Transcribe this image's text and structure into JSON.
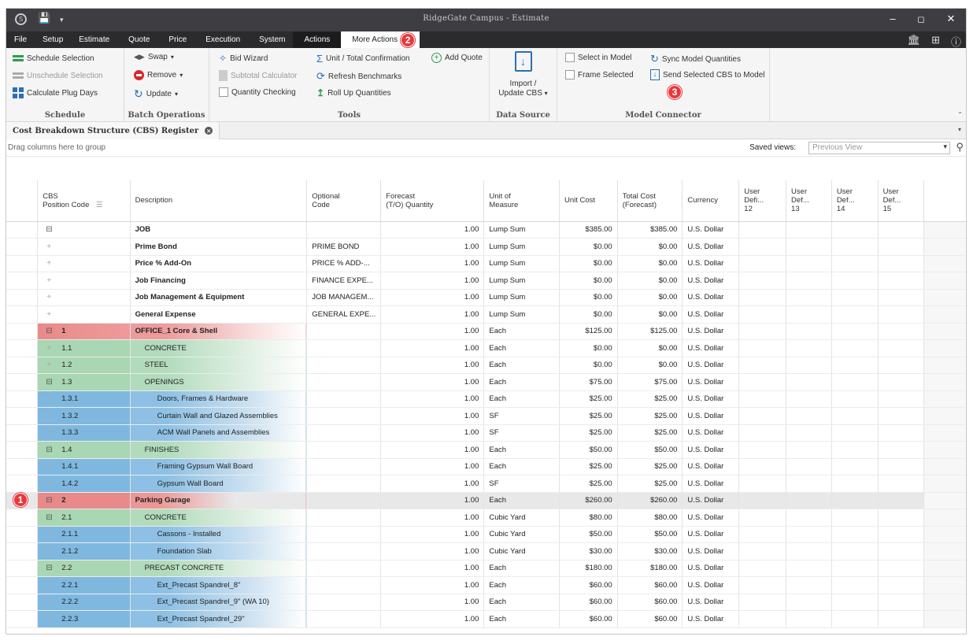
{
  "window": {
    "title": "RidgeGate Campus - Estimate"
  },
  "menu": {
    "items": [
      "File",
      "Setup",
      "Estimate",
      "Quote",
      "Price",
      "Execution",
      "System",
      "Actions",
      "More Actions"
    ],
    "badge": "2"
  },
  "ribbon": {
    "schedule": {
      "label": "Schedule",
      "items": [
        "Schedule Selection",
        "Unschedule Selection",
        "Calculate Plug Days"
      ]
    },
    "batch": {
      "label": "Batch Operations",
      "swap": "Swap",
      "remove": "Remove",
      "update": "Update"
    },
    "tools": {
      "label": "Tools",
      "bid_wizard": "Bid Wizard",
      "subtotal": "Subtotal Calculator",
      "qty_check": "Quantity Checking",
      "unit_total": "Unit / Total Confirmation",
      "refresh": "Refresh Benchmarks",
      "rollup": "Roll Up Quantities",
      "add_quote": "Add Quote"
    },
    "data_source": {
      "label": "Data Source",
      "import_line1": "Import /",
      "import_line2": "Update CBS"
    },
    "model": {
      "label": "Model Connector",
      "select": "Select in Model",
      "frame": "Frame Selected",
      "sync": "Sync Model Quantities",
      "send": "Send Selected CBS to Model",
      "badge": "3"
    }
  },
  "doc_tab": {
    "label": "Cost Breakdown Structure (CBS) Register"
  },
  "grid_bar": {
    "hint": "Drag columns here to group",
    "saved_views_label": "Saved views:",
    "saved_views_value": "Previous View"
  },
  "columns": {
    "cbs": "CBS",
    "cbs2": "Position Code",
    "desc": "Description",
    "opt1": "Optional",
    "opt2": "Code",
    "fq1": "Forecast",
    "fq2": "(T/O) Quantity",
    "uom1": "Unit of",
    "uom2": "Measure",
    "uc": "Unit Cost",
    "tc1": "Total Cost",
    "tc2": "(Forecast)",
    "cur": "Currency",
    "u12a": "User",
    "u12b": "Defi...",
    "u12c": "12",
    "u13a": "User",
    "u13b": "Def...",
    "u13c": "13",
    "u14a": "User",
    "u14b": "Def...",
    "u14c": "14",
    "u15a": "User",
    "u15b": "Def...",
    "u15c": "15"
  },
  "rows": [
    {
      "code": "",
      "desc": "JOB",
      "opt": "",
      "qty": "1.00",
      "uom": "Lump Sum",
      "uc": "$385.00",
      "tc": "$385.00",
      "cur": "U.S. Dollar"
    },
    {
      "code": "",
      "desc": "Prime Bond",
      "opt": "PRIME BOND",
      "qty": "1.00",
      "uom": "Lump Sum",
      "uc": "$0.00",
      "tc": "$0.00",
      "cur": "U.S. Dollar"
    },
    {
      "code": "",
      "desc": "Price % Add-On",
      "opt": "PRICE % ADD-...",
      "qty": "1.00",
      "uom": "Lump Sum",
      "uc": "$0.00",
      "tc": "$0.00",
      "cur": "U.S. Dollar"
    },
    {
      "code": "",
      "desc": "Job Financing",
      "opt": "FINANCE EXPE...",
      "qty": "1.00",
      "uom": "Lump Sum",
      "uc": "$0.00",
      "tc": "$0.00",
      "cur": "U.S. Dollar"
    },
    {
      "code": "",
      "desc": "Job Management & Equipment",
      "opt": "JOB MANAGEM...",
      "qty": "1.00",
      "uom": "Lump Sum",
      "uc": "$0.00",
      "tc": "$0.00",
      "cur": "U.S. Dollar"
    },
    {
      "code": "",
      "desc": "General Expense",
      "opt": "GENERAL EXPE...",
      "qty": "1.00",
      "uom": "Lump Sum",
      "uc": "$0.00",
      "tc": "$0.00",
      "cur": "U.S. Dollar"
    },
    {
      "code": "1",
      "desc": "OFFICE_1 Core & Shell",
      "opt": "",
      "qty": "1.00",
      "uom": "Each",
      "uc": "$125.00",
      "tc": "$125.00",
      "cur": "U.S. Dollar"
    },
    {
      "code": "1.1",
      "desc": "CONCRETE",
      "opt": "",
      "qty": "1.00",
      "uom": "Each",
      "uc": "$0.00",
      "tc": "$0.00",
      "cur": "U.S. Dollar"
    },
    {
      "code": "1.2",
      "desc": "STEEL",
      "opt": "",
      "qty": "1.00",
      "uom": "Each",
      "uc": "$0.00",
      "tc": "$0.00",
      "cur": "U.S. Dollar"
    },
    {
      "code": "1.3",
      "desc": "OPENINGS",
      "opt": "",
      "qty": "1.00",
      "uom": "Each",
      "uc": "$75.00",
      "tc": "$75.00",
      "cur": "U.S. Dollar"
    },
    {
      "code": "1.3.1",
      "desc": "Doors, Frames & Hardware",
      "opt": "",
      "qty": "1.00",
      "uom": "Each",
      "uc": "$25.00",
      "tc": "$25.00",
      "cur": "U.S. Dollar"
    },
    {
      "code": "1.3.2",
      "desc": "Curtain Wall and Glazed Assemblies",
      "opt": "",
      "qty": "1.00",
      "uom": "SF",
      "uc": "$25.00",
      "tc": "$25.00",
      "cur": "U.S. Dollar"
    },
    {
      "code": "1.3.3",
      "desc": "ACM Wall Panels and Assemblies",
      "opt": "",
      "qty": "1.00",
      "uom": "SF",
      "uc": "$25.00",
      "tc": "$25.00",
      "cur": "U.S. Dollar"
    },
    {
      "code": "1.4",
      "desc": "FINISHES",
      "opt": "",
      "qty": "1.00",
      "uom": "Each",
      "uc": "$50.00",
      "tc": "$50.00",
      "cur": "U.S. Dollar"
    },
    {
      "code": "1.4.1",
      "desc": "Framing Gypsum Wall Board",
      "opt": "",
      "qty": "1.00",
      "uom": "Each",
      "uc": "$25.00",
      "tc": "$25.00",
      "cur": "U.S. Dollar"
    },
    {
      "code": "1.4.2",
      "desc": "Gypsum Wall Board",
      "opt": "",
      "qty": "1.00",
      "uom": "SF",
      "uc": "$25.00",
      "tc": "$25.00",
      "cur": "U.S. Dollar"
    },
    {
      "code": "2",
      "desc": "Parking Garage",
      "opt": "",
      "qty": "1.00",
      "uom": "Each",
      "uc": "$260.00",
      "tc": "$260.00",
      "cur": "U.S. Dollar"
    },
    {
      "code": "2.1",
      "desc": "CONCRETE",
      "opt": "",
      "qty": "1.00",
      "uom": "Cubic Yard",
      "uc": "$80.00",
      "tc": "$80.00",
      "cur": "U.S. Dollar"
    },
    {
      "code": "2.1.1",
      "desc": "Cassons - Installed",
      "opt": "",
      "qty": "1.00",
      "uom": "Cubic Yard",
      "uc": "$50.00",
      "tc": "$50.00",
      "cur": "U.S. Dollar"
    },
    {
      "code": "2.1.2",
      "desc": "Foundation Slab",
      "opt": "",
      "qty": "1.00",
      "uom": "Cubic Yard",
      "uc": "$30.00",
      "tc": "$30.00",
      "cur": "U.S. Dollar"
    },
    {
      "code": "2.2",
      "desc": "PRECAST CONCRETE",
      "opt": "",
      "qty": "1.00",
      "uom": "Each",
      "uc": "$180.00",
      "tc": "$180.00",
      "cur": "U.S. Dollar"
    },
    {
      "code": "2.2.1",
      "desc": "Ext_Precast Spandrel_8\"",
      "opt": "",
      "qty": "1.00",
      "uom": "Each",
      "uc": "$60.00",
      "tc": "$60.00",
      "cur": "U.S. Dollar"
    },
    {
      "code": "2.2.2",
      "desc": "Ext_Precast Spandrel_9\" (WA 10)",
      "opt": "",
      "qty": "1.00",
      "uom": "Each",
      "uc": "$60.00",
      "tc": "$60.00",
      "cur": "U.S. Dollar"
    },
    {
      "code": "2.2.3",
      "desc": "Ext_Precast Spandrel_29\"",
      "opt": "",
      "qty": "1.00",
      "uom": "Each",
      "uc": "$60.00",
      "tc": "$60.00",
      "cur": "U.S. Dollar"
    }
  ],
  "callout": {
    "one": "1"
  }
}
